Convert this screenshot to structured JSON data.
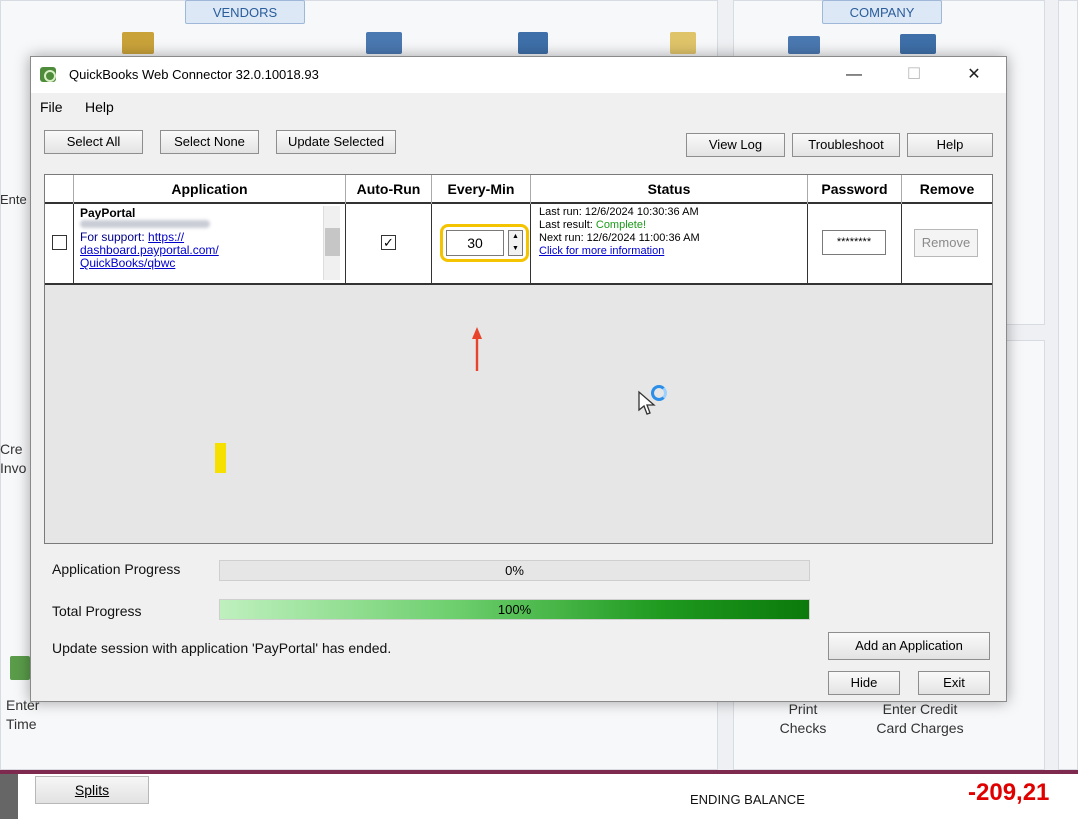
{
  "background": {
    "vendors_label": "VENDORS",
    "company_label": "COMPANY",
    "left_label_1": "Ente",
    "left_label_2": "Cre\nInvo",
    "left_label_3": "Enter\nTime",
    "print_checks": "Print\nChecks",
    "enter_credit": "Enter Credit\nCard Charges",
    "splits_label": "Splits",
    "ending_balance_label": "ENDING BALANCE",
    "ending_balance_value": "-209,21",
    "colors": {
      "balance": "#e00000",
      "register_border": "#7d2a4e"
    }
  },
  "window": {
    "title": "QuickBooks Web Connector 32.0.10018.93",
    "minimize_glyph": "—",
    "maximize_glyph": "☐",
    "close_glyph": "✕"
  },
  "menu": {
    "file": "File",
    "help": "Help"
  },
  "toolbar": {
    "select_all": "Select All",
    "select_none": "Select None",
    "update_selected": "Update Selected",
    "view_log": "View Log",
    "troubleshoot": "Troubleshoot",
    "help": "Help"
  },
  "grid": {
    "headers": {
      "application": "Application",
      "auto_run": "Auto-Run",
      "every_min": "Every-Min",
      "status": "Status",
      "password": "Password",
      "remove": "Remove"
    },
    "row": {
      "app_name": "PayPortal",
      "support_prefix": "For support:",
      "support_link_1": "https://",
      "support_link_2": "dashboard.payportal.com/",
      "support_link_3": "QuickBooks/qbwc",
      "auto_run_checked": true,
      "every_min": "30",
      "last_run": "Last run: 12/6/2024 10:30:36 AM",
      "last_result_label": "Last result:",
      "last_result_value": "Complete!",
      "next_run": "Next run: 12/6/2024 11:00:36 AM",
      "more_info": "Click for more information",
      "password": "********",
      "remove_label": "Remove"
    }
  },
  "progress": {
    "application_label": "Application Progress",
    "application_value": "0%",
    "application_fraction": 0,
    "total_label": "Total Progress",
    "total_value": "100%",
    "total_fraction": 1
  },
  "footer": {
    "message": "Update session with application 'PayPortal' has ended.",
    "add_application": "Add an Application",
    "hide": "Hide",
    "exit": "Exit"
  },
  "icons": [
    "quickbooks-connector-icon",
    "up-arrow-icon",
    "mouse-cursor-icon",
    "loading-ring-icon",
    "checkmark-icon",
    "spin-up-icon",
    "spin-down-icon"
  ]
}
